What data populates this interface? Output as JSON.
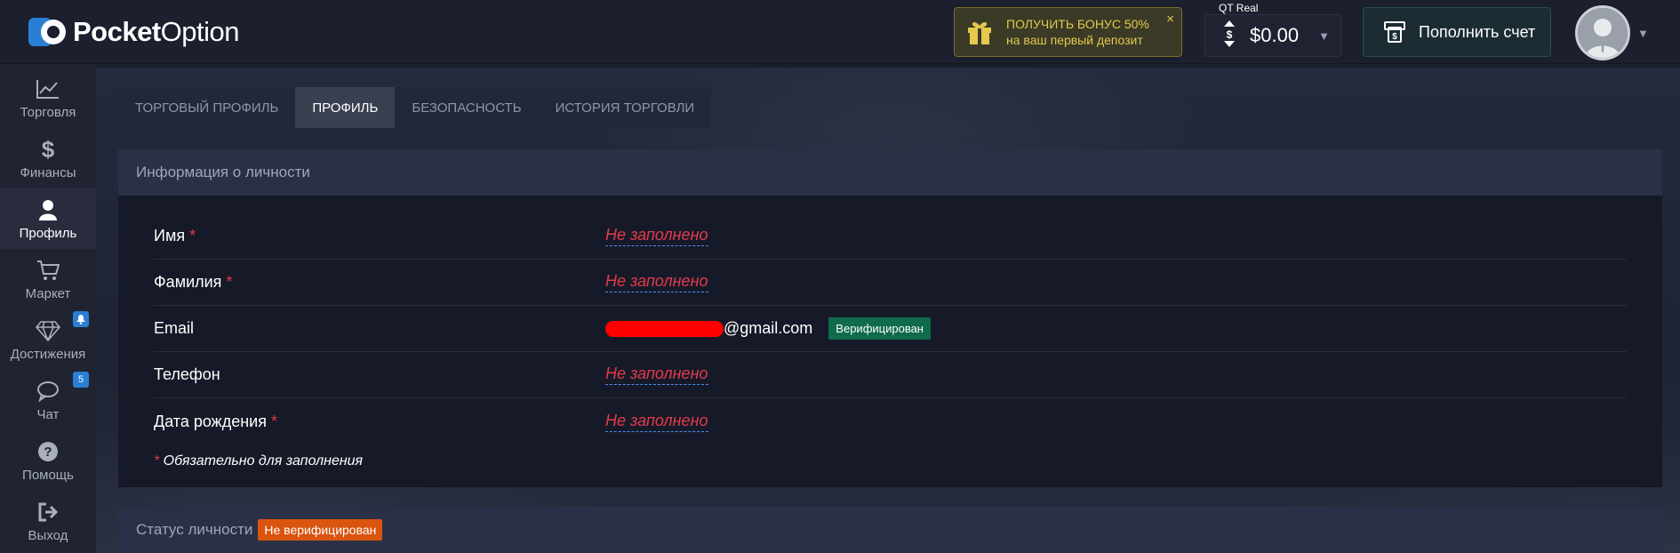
{
  "brand": {
    "name_bold": "Pocket",
    "name_thin": "Option",
    "accent": "#2a7fd4"
  },
  "header": {
    "bonus": {
      "line1": "ПОЛУЧИТЬ БОНУС 50%",
      "line2": "на ваш первый депозит",
      "close": "×",
      "icon": "gift-icon"
    },
    "balance": {
      "label": "QT Real",
      "amount": "$0.00",
      "caret": "▼"
    },
    "deposit": {
      "label": "Пополнить счет",
      "icon": "deposit-icon"
    },
    "avatar": {
      "caret": "▼"
    }
  },
  "sidebar": {
    "items": [
      {
        "label": "Торговля",
        "icon": "chart-icon",
        "active": false
      },
      {
        "label": "Финансы",
        "icon": "dollar-icon",
        "active": false
      },
      {
        "label": "Профиль",
        "icon": "user-icon",
        "active": true
      },
      {
        "label": "Маркет",
        "icon": "cart-icon",
        "active": false
      },
      {
        "label": "Достижения",
        "icon": "diamond-icon",
        "active": false,
        "badge": "bell"
      },
      {
        "label": "Чат",
        "icon": "chat-icon",
        "active": false,
        "badge": "5"
      },
      {
        "label": "Помощь",
        "icon": "help-icon",
        "active": false
      },
      {
        "label": "Выход",
        "icon": "logout-icon",
        "active": false
      }
    ]
  },
  "tabs": [
    {
      "label": "ТОРГОВЫЙ ПРОФИЛЬ",
      "active": false
    },
    {
      "label": "ПРОФИЛЬ",
      "active": true
    },
    {
      "label": "БЕЗОПАСНОСТЬ",
      "active": false
    },
    {
      "label": "ИСТОРИЯ ТОРГОВЛИ",
      "active": false
    }
  ],
  "personal": {
    "title": "Информация о личности",
    "rows": [
      {
        "key": "Имя",
        "required": "*",
        "value": "Не заполнено"
      },
      {
        "key": "Фамилия",
        "required": "*",
        "value": "Не заполнено"
      },
      {
        "key": "Email",
        "required": "",
        "value": "@gmail.com",
        "badge": "Верифицирован"
      },
      {
        "key": "Телефон",
        "required": "",
        "value": "Не заполнено"
      },
      {
        "key": "Дата рождения",
        "required": "*",
        "value": "Не заполнено"
      }
    ],
    "note_star": "*",
    "note": " Обязательно для заполнения"
  },
  "status": {
    "title": "Статус личности",
    "badge": "Не верифицирован"
  },
  "colors": {
    "required": "#e23a4b",
    "verified": "#0f6b4a",
    "unverified": "#d9540f",
    "bonus_text": "#e5c84c"
  }
}
